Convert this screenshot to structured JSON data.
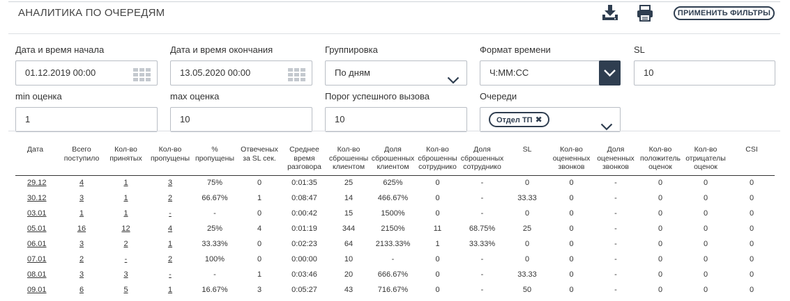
{
  "header": {
    "title": "АНАЛИТИКА ПО ОЧЕРЕДЯМ",
    "download_icon": "download-icon",
    "print_icon": "printer-icon",
    "apply_label": "ПРИМЕНИТЬ ФИЛЬТРЫ"
  },
  "colors": {
    "accent": "#2f3e50",
    "border": "#b9bec5",
    "separator": "#dcdfe3"
  },
  "filters": {
    "start": {
      "label": "Дата и время начала",
      "value": "01.12.2019 00:00"
    },
    "end": {
      "label": "Дата и время окончания",
      "value": "13.05.2020 00:00"
    },
    "grouping": {
      "label": "Группировка",
      "value": "По дням"
    },
    "time_format": {
      "label": "Формат времени",
      "value": "Ч:ММ:СС"
    },
    "sl": {
      "label": "SL",
      "value": "10"
    },
    "min_score": {
      "label": "min оценка",
      "value": "1"
    },
    "max_score": {
      "label": "max оценка",
      "value": "10"
    },
    "threshold": {
      "label": "Порог успешного вызова",
      "value": "10"
    },
    "queues": {
      "label": "Очереди",
      "tag": "Отдел ТП"
    }
  },
  "table": {
    "headers": [
      [
        "Дата"
      ],
      [
        "Всего",
        "поступило"
      ],
      [
        "Кол-во",
        "принятых"
      ],
      [
        "Кол-во",
        "пропущены"
      ],
      [
        "%",
        "пропущены"
      ],
      [
        "Отвеченых",
        "за SL сек."
      ],
      [
        "Среднее",
        "время",
        "разговора"
      ],
      [
        "Кол-во",
        "сброшенны",
        "клиентом"
      ],
      [
        "Доля",
        "сброшенных",
        "клиентом"
      ],
      [
        "Кол-во",
        "сброшенны",
        "сотруднико"
      ],
      [
        "Доля",
        "сброшенных",
        "сотруднико"
      ],
      [
        "SL"
      ],
      [
        "Кол-во",
        "оцененных",
        "звонков"
      ],
      [
        "Доля",
        "оцененных",
        "звонков"
      ],
      [
        "Кол-во",
        "положитель",
        "оценок"
      ],
      [
        "Кол-во",
        "отрицателы",
        "оценок"
      ],
      [
        "CSI"
      ]
    ],
    "rows": [
      [
        "29.12",
        "4",
        "1",
        "3",
        "75%",
        "0",
        "0:01:35",
        "25",
        "625%",
        "0",
        "-",
        "0",
        "0",
        "-",
        "0",
        "0",
        "0"
      ],
      [
        "30.12",
        "3",
        "1",
        "2",
        "66.67%",
        "1",
        "0:08:47",
        "14",
        "466.67%",
        "0",
        "-",
        "33.33",
        "0",
        "-",
        "0",
        "0",
        "0"
      ],
      [
        "03.01",
        "1",
        "1",
        "-",
        "-",
        "0",
        "0:00:42",
        "15",
        "1500%",
        "0",
        "-",
        "0",
        "0",
        "-",
        "0",
        "0",
        "0"
      ],
      [
        "05.01",
        "16",
        "12",
        "4",
        "25%",
        "4",
        "0:01:19",
        "344",
        "2150%",
        "11",
        "68.75%",
        "25",
        "0",
        "-",
        "0",
        "0",
        "0"
      ],
      [
        "06.01",
        "3",
        "2",
        "1",
        "33.33%",
        "0",
        "0:02:23",
        "64",
        "2133.33%",
        "1",
        "33.33%",
        "0",
        "0",
        "-",
        "0",
        "0",
        "0"
      ],
      [
        "07.01",
        "2",
        "-",
        "2",
        "100%",
        "0",
        "0:00:00",
        "10",
        "-",
        "0",
        "-",
        "0",
        "0",
        "-",
        "0",
        "0",
        "0"
      ],
      [
        "08.01",
        "3",
        "3",
        "-",
        "-",
        "1",
        "0:03:46",
        "20",
        "666.67%",
        "0",
        "-",
        "33.33",
        "0",
        "-",
        "0",
        "0",
        "0"
      ],
      [
        "09.01",
        "6",
        "5",
        "1",
        "16.67%",
        "3",
        "0:05:27",
        "43",
        "716.67%",
        "0",
        "-",
        "50",
        "0",
        "-",
        "0",
        "0",
        "0"
      ]
    ]
  }
}
